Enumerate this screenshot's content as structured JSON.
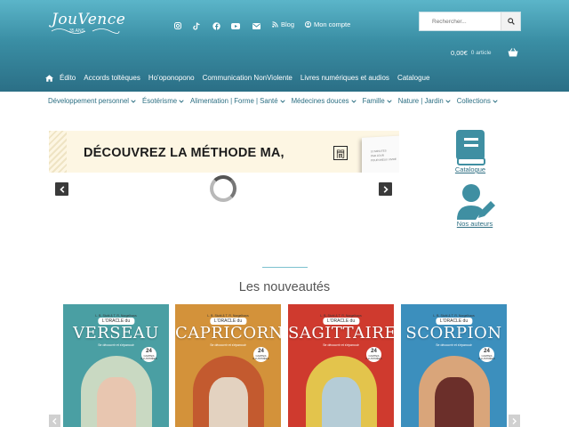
{
  "header": {
    "logo_text": "JouVence",
    "logo_sub": "35 ANS",
    "social_icons": [
      "instagram-icon",
      "tiktok-icon",
      "facebook-icon",
      "youtube-icon",
      "email-icon"
    ],
    "blog_label": "Blog",
    "account_label": "Mon compte",
    "search": {
      "placeholder": "Rechercher..."
    },
    "cart": {
      "amount": "0,00€",
      "count": "0 article"
    }
  },
  "main_nav": [
    "Édito",
    "Accords toltèques",
    "Ho'oponopono",
    "Communication NonViolente",
    "Livres numériques et audios",
    "Catalogue"
  ],
  "secondary_nav": [
    "Développement personnel",
    "Ésotérisme",
    "Alimentation | Forme | Santé",
    "Médecines douces",
    "Famille",
    "Nature | Jardin",
    "Collections"
  ],
  "banner": {
    "text": "DÉCOUVREZ LA MÉTHODE MA,",
    "kanji": "間",
    "book_lines": [
      "10 MINUTES",
      "PAR JOUR",
      "POUR MIEUX VIVRE"
    ]
  },
  "side_links": {
    "catalogue": "Catalogue",
    "authors": "Nos auteurs"
  },
  "new_releases": {
    "title": "Les nouveautés",
    "books": [
      {
        "authors": "L. B. Stuhl & T. R. Norgelhaus",
        "oracle": "L'ORACLE du",
        "sign": "VERSEAU",
        "sub": "Se découvrir et s'épanouir",
        "badge_num": "24",
        "badge_text": "CARTES ILLUSTRÉES",
        "bg": "#4a9fa3",
        "art": "#c9d9c2",
        "art2": "#e8c6b0"
      },
      {
        "authors": "L. B. Stuhl & T. R. Norgelhaus",
        "oracle": "L'ORACLE du",
        "sign": "CAPRICORNE",
        "sub": "Se découvrir et s'épanouir",
        "badge_num": "24",
        "badge_text": "CARTES ILLUSTRÉES",
        "bg": "#d3923a",
        "art": "#c35a2f",
        "art2": "#e3d2c0"
      },
      {
        "authors": "L. B. Stuhl & T. R. Norgelhaus",
        "oracle": "L'ORACLE du",
        "sign": "SAGITTAIRE",
        "sub": "Se découvrir et s'épanouir",
        "badge_num": "24",
        "badge_text": "CARTES ILLUSTRÉES",
        "bg": "#cf3a2e",
        "art": "#e3c44c",
        "art2": "#b5ccd6"
      },
      {
        "authors": "L. B. Stuhl & T. R. Norgelhaus",
        "oracle": "L'ORACLE du",
        "sign": "SCORPION",
        "sub": "Se découvrir et s'épanouir",
        "badge_num": "24",
        "badge_text": "CARTES ILLUSTRÉES",
        "bg": "#3c8fbd",
        "art": "#d9a57a",
        "art2": "#6b2f2a"
      }
    ]
  },
  "colors": {
    "header_top": "#5bb5c9",
    "header_bottom": "#2b6f86",
    "link": "#2c6f83",
    "icon_teal": "#3f8fa2"
  }
}
